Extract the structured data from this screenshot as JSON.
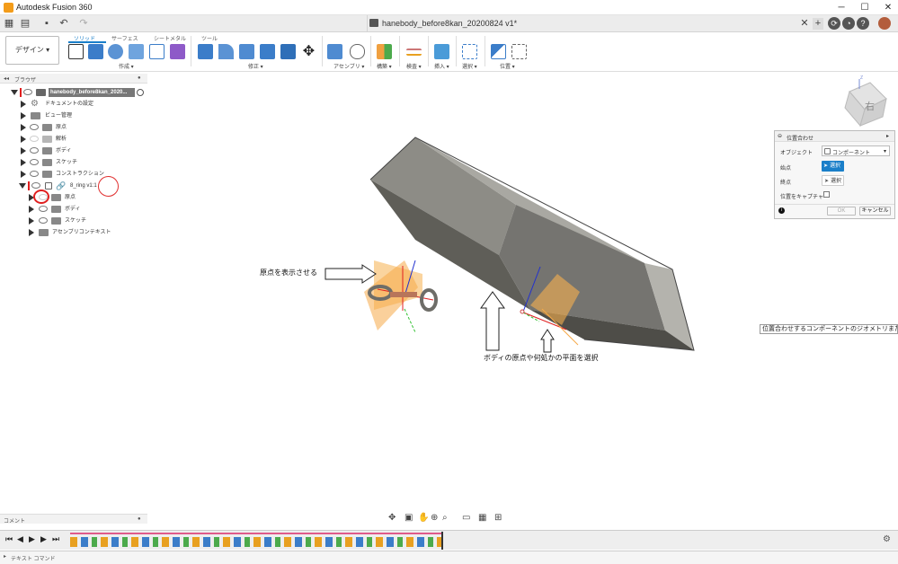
{
  "app_title": "Autodesk Fusion 360",
  "document_title": "hanebody_before8kan_20200824 v1*",
  "workspace_button": "デザイン ▾",
  "tabs": {
    "solid": "ソリッド",
    "surface": "サーフェス",
    "sheet_metal": "シートメタル",
    "tools": "ツール"
  },
  "tool_groups": {
    "create": "作成 ▾",
    "modify": "修正 ▾",
    "assemble": "アセンブリ ▾",
    "construct": "構築 ▾",
    "inspect": "検査 ▾",
    "insert": "挿入 ▾",
    "select": "選択 ▾",
    "position": "位置 ▾"
  },
  "browser": {
    "header": "ブラウザ",
    "root": "hanebody_before8kan_2020...",
    "items": [
      "ドキュメントの設定",
      "ビュー管理",
      "原点",
      "解析",
      "ボディ",
      "スケッチ",
      "コンストラクション"
    ],
    "component": "8_ring v1:1",
    "sub_items": [
      "原点",
      "ボディ",
      "スケッチ",
      "アセンブリコンテキスト"
    ]
  },
  "comments_label": "コメント",
  "text_command_label": "テキスト コマンド",
  "align_panel": {
    "title": "位置合わせ",
    "object_label": "オブジェクト",
    "object_value": "コンポーネント",
    "from_label": "始点",
    "from_button": "選択",
    "to_label": "終点",
    "to_button": "選択",
    "capture_label": "位置をキャプチャ",
    "ok": "OK",
    "cancel": "キャンセル"
  },
  "tooltip": "位置合わせするコンポーネントのジオメトリまたはスナップ点を選",
  "annotations": {
    "show_origin": "原点を表示させる",
    "select_plane": "ボディの原点や何処かの平面を選択"
  },
  "viewcube_label": "右",
  "colors": {
    "accent": "#1a7fc9",
    "red_marker": "#e02020",
    "plane_orange": "#f6a948",
    "body_dark": "#6b6a64",
    "body_light": "#a4a39d"
  }
}
